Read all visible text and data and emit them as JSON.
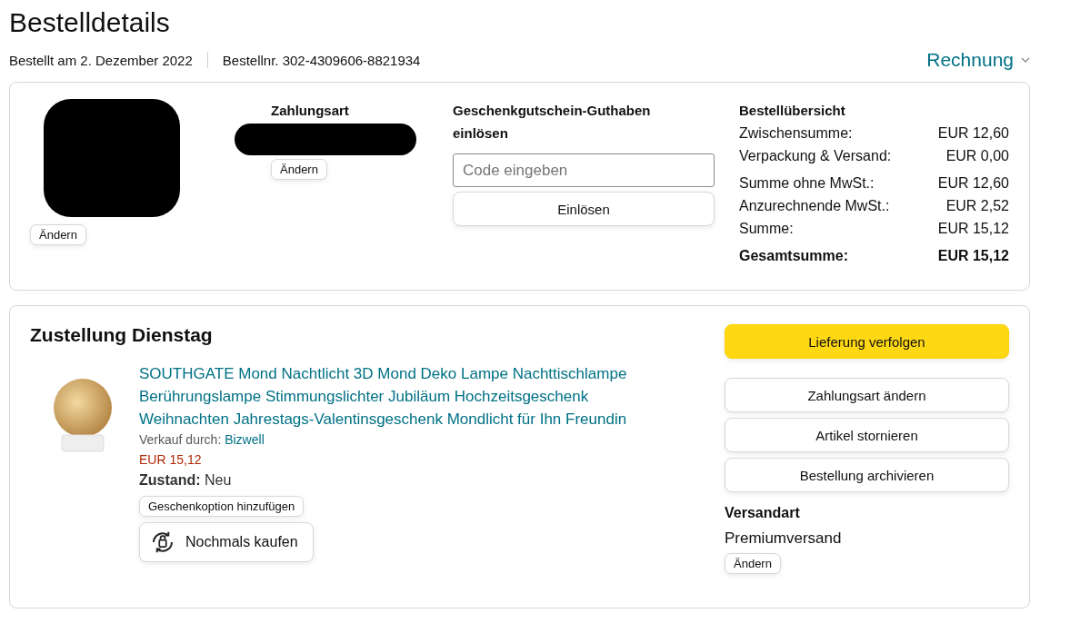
{
  "title": "Bestelldetails",
  "order_meta": {
    "ordered": "Bestellt am 2. Dezember 2022",
    "order_number": "Bestellnr. 302-4309606-8821934"
  },
  "invoice_link": "Rechnung",
  "summary_card": {
    "address": {
      "change_button": "Ändern"
    },
    "payment": {
      "heading": "Zahlungsart",
      "change_button": "Ändern"
    },
    "gift_card": {
      "heading": "Geschenkgutschein-Guthaben einlösen",
      "placeholder": "Code eingeben",
      "button": "Einlösen"
    },
    "order_summary": {
      "heading": "Bestellübersicht",
      "rows": [
        {
          "label": "Zwischensumme:",
          "value": "EUR 12,60",
          "kind": "normal"
        },
        {
          "label": "Verpackung & Versand:",
          "value": "EUR 0,00",
          "kind": "normal"
        },
        {
          "label": "Summe ohne MwSt.:",
          "value": "EUR 12,60",
          "kind": "normal"
        },
        {
          "label": "Anzurechnende MwSt.:",
          "value": "EUR 2,52",
          "kind": "normal"
        },
        {
          "label": "Summe:",
          "value": "EUR 15,12",
          "kind": "normal"
        },
        {
          "label": "Gesamtsumme:",
          "value": "EUR 15,12",
          "kind": "total"
        }
      ]
    }
  },
  "shipment": {
    "heading": "Zustellung Dienstag",
    "item": {
      "title": "SOUTHGATE Mond Nachtlicht 3D Mond Deko Lampe Nachttischlampe Berührungslampe Stimmungslichter Jubiläum Hochzeitsgeschenk Weihnachten Jahrestags-Valentinsgeschenk Mondlicht für Ihn Freundin",
      "seller_label": "Verkauf durch:",
      "seller": "Bizwell",
      "price": "EUR 15,12",
      "condition_label": "Zustand:",
      "condition": "Neu",
      "gift_button": "Geschenkoption hinzufügen",
      "buy_again_button": "Nochmals kaufen"
    },
    "actions": [
      {
        "label": "Lieferung verfolgen",
        "kind": "primary"
      },
      {
        "label": "Zahlungsart ändern",
        "kind": "secondary"
      },
      {
        "label": "Artikel stornieren",
        "kind": "secondary"
      },
      {
        "label": "Bestellung archivieren",
        "kind": "secondary"
      }
    ],
    "shipping": {
      "heading": "Versandart",
      "method": "Premiumversand",
      "change_button": "Ändern"
    }
  }
}
